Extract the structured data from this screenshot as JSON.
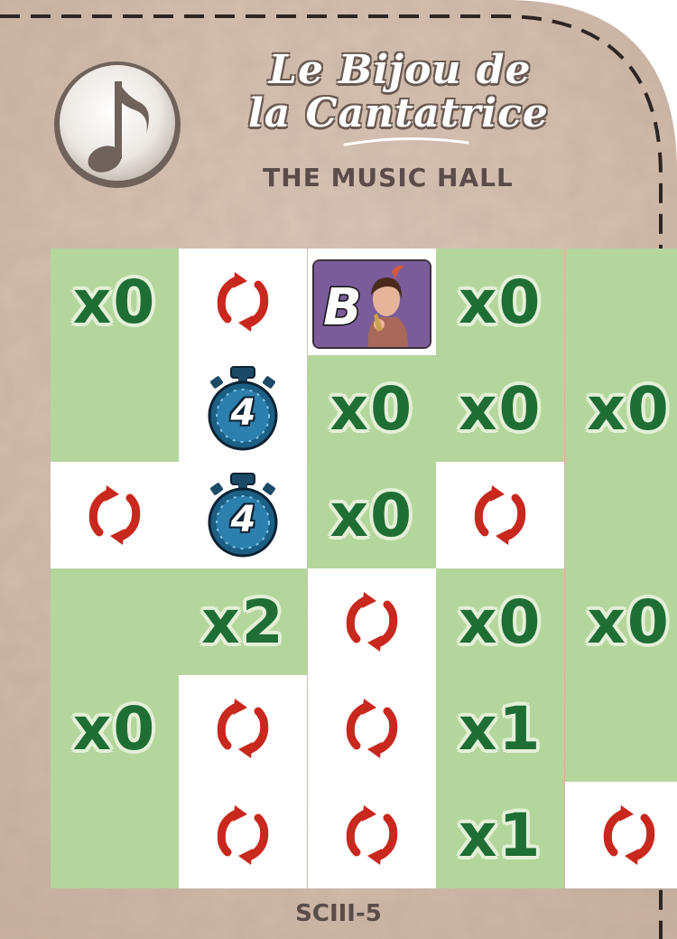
{
  "card": {
    "title_line1": "Le Bijou de",
    "title_line2": "la Cantatrice",
    "subtitle": "THE MUSIC HALL",
    "code": "SCIII-5",
    "icon": "music-note-icon",
    "colors": {
      "parchment": "#d7c2b4",
      "green": "#b4d69d",
      "multiplier_text": "#1f6e35",
      "rotate_arrows": "#c8281e",
      "timer": "#1c5f84"
    }
  },
  "grid": {
    "rows": [
      [
        {
          "type": "multiplier",
          "label": "x0"
        },
        {
          "type": "rotate"
        },
        {
          "type": "character",
          "label": "B"
        },
        {
          "type": "multiplier",
          "label": "x0"
        },
        {
          "type": "empty"
        }
      ],
      [
        {
          "type": "empty"
        },
        {
          "type": "timer",
          "label": "4"
        },
        {
          "type": "multiplier",
          "label": "x0"
        },
        {
          "type": "multiplier",
          "label": "x0"
        },
        {
          "type": "multiplier",
          "label": "x0"
        }
      ],
      [
        {
          "type": "rotate"
        },
        {
          "type": "timer",
          "label": "4"
        },
        {
          "type": "multiplier",
          "label": "x0"
        },
        {
          "type": "rotate"
        },
        {
          "type": "empty"
        }
      ],
      [
        {
          "type": "empty"
        },
        {
          "type": "multiplier",
          "label": "x2"
        },
        {
          "type": "rotate"
        },
        {
          "type": "multiplier",
          "label": "x0"
        },
        {
          "type": "multiplier",
          "label": "x0"
        }
      ],
      [
        {
          "type": "multiplier",
          "label": "x0"
        },
        {
          "type": "rotate"
        },
        {
          "type": "rotate"
        },
        {
          "type": "multiplier",
          "label": "x1"
        },
        {
          "type": "empty"
        }
      ],
      [
        {
          "type": "empty"
        },
        {
          "type": "rotate"
        },
        {
          "type": "rotate"
        },
        {
          "type": "multiplier",
          "label": "x1"
        },
        {
          "type": "rotate"
        }
      ]
    ]
  }
}
